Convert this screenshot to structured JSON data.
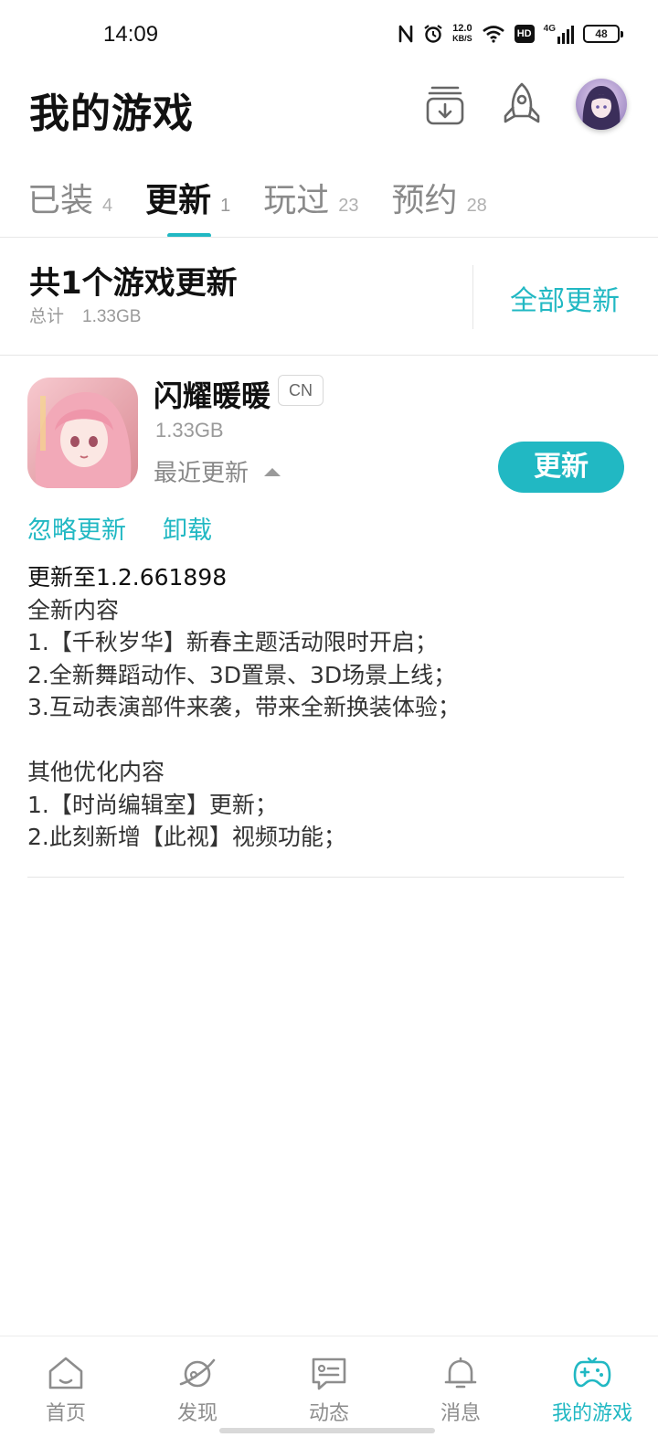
{
  "status_bar": {
    "time": "14:09",
    "net_speed_value": "12.0",
    "net_speed_unit": "KB/S",
    "hd_label": "HD",
    "network_label": "4G",
    "battery": "48"
  },
  "header": {
    "title": "我的游戏",
    "icons": [
      "download-box-icon",
      "rocket-icon",
      "avatar"
    ]
  },
  "tabs": [
    {
      "label": "已装",
      "count": "4",
      "active": false
    },
    {
      "label": "更新",
      "count": "1",
      "active": true
    },
    {
      "label": "玩过",
      "count": "23",
      "active": false
    },
    {
      "label": "预约",
      "count": "28",
      "active": false
    }
  ],
  "summary": {
    "title": "共1个游戏更新",
    "total_label": "总计",
    "total_size": "1.33GB",
    "update_all_label": "全部更新"
  },
  "game": {
    "name": "闪耀暖暖",
    "region": "CN",
    "size": "1.33GB",
    "recent_update_label": "最近更新",
    "update_button": "更新",
    "ignore_label": "忽略更新",
    "uninstall_label": "卸载",
    "changelog": [
      "更新至1.2.661898",
      "全新内容",
      "1.【千秋岁华】新春主题活动限时开启；",
      "2.全新舞蹈动作、3D置景、3D场景上线；",
      "3.互动表演部件来袭，带来全新换装体验；",
      "",
      "其他优化内容",
      "1.【时尚编辑室】更新；",
      "2.此刻新增【此视】视频功能；"
    ]
  },
  "bottom_nav": [
    {
      "label": "首页",
      "icon": "home-icon",
      "active": false
    },
    {
      "label": "发现",
      "icon": "planet-icon",
      "active": false
    },
    {
      "label": "动态",
      "icon": "chat-card-icon",
      "active": false
    },
    {
      "label": "消息",
      "icon": "bell-icon",
      "active": false
    },
    {
      "label": "我的游戏",
      "icon": "gamepad-icon",
      "active": true
    }
  ],
  "colors": {
    "accent": "#21b8c3",
    "text_primary": "#111111",
    "text_secondary": "#9a9a9a"
  }
}
